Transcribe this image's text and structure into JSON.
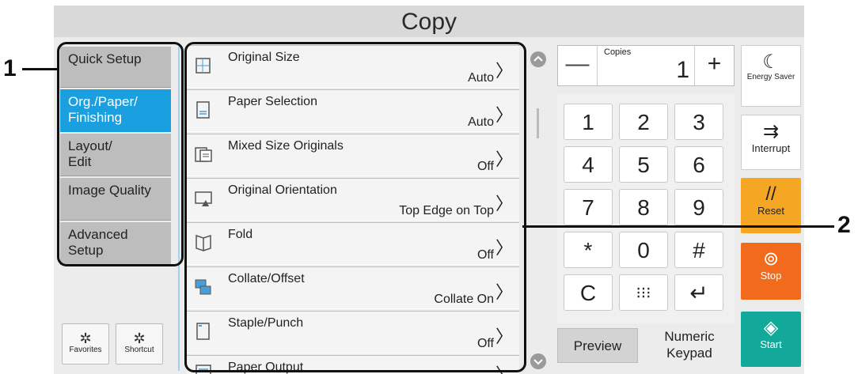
{
  "screen": {
    "title": "Copy"
  },
  "tabs": [
    {
      "label": "Quick Setup",
      "active": false
    },
    {
      "label": "Org./Paper/\nFinishing",
      "active": true
    },
    {
      "label": "Layout/\nEdit",
      "active": false
    },
    {
      "label": "Image Quality",
      "active": false
    },
    {
      "label": "Advanced\nSetup",
      "active": false
    }
  ],
  "bottom_buttons": {
    "favorites": "Favorites",
    "shortcut": "Shortcut"
  },
  "functions": [
    {
      "label": "Original Size",
      "value": "Auto",
      "icon": "original-size-icon"
    },
    {
      "label": "Paper Selection",
      "value": "Auto",
      "icon": "paper-selection-icon"
    },
    {
      "label": "Mixed Size Originals",
      "value": "Off",
      "icon": "mixed-size-originals-icon"
    },
    {
      "label": "Original Orientation",
      "value": "Top Edge on Top",
      "icon": "original-orientation-icon"
    },
    {
      "label": "Fold",
      "value": "Off",
      "icon": "fold-icon"
    },
    {
      "label": "Collate/Offset",
      "value": "Collate On",
      "icon": "collate-offset-icon"
    },
    {
      "label": "Staple/Punch",
      "value": "Off",
      "icon": "staple-punch-icon"
    },
    {
      "label": "Paper Output",
      "value": "",
      "icon": "paper-output-icon"
    }
  ],
  "copies": {
    "label": "Copies",
    "value": "1",
    "minus": "—",
    "plus": "+"
  },
  "keypad": {
    "keys": [
      "1",
      "2",
      "3",
      "4",
      "5",
      "6",
      "7",
      "8",
      "9",
      "*",
      "0",
      "#",
      "C",
      "⁝⁝⁝",
      "↵"
    ]
  },
  "preview": "Preview",
  "numeric_keypad": "Numeric\nKeypad",
  "side_buttons": {
    "energy_saver": "Energy Saver",
    "interrupt": "Interrupt",
    "reset": "Reset",
    "stop": "Stop",
    "start": "Start"
  },
  "callouts": {
    "one": "1",
    "two": "2"
  },
  "colors": {
    "active_tab": "#1a9fe0",
    "reset": "#f5a623",
    "stop": "#f26a1b",
    "start": "#12a99b"
  }
}
